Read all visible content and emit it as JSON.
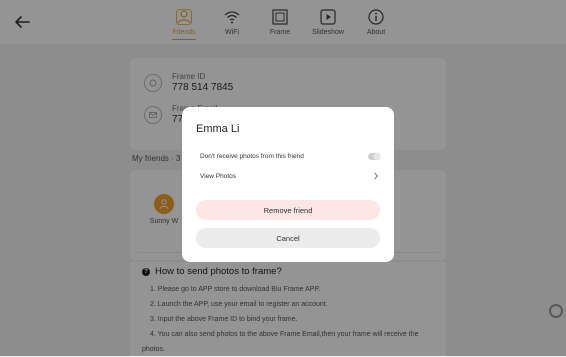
{
  "header": {
    "tabs": [
      {
        "label": "Friends",
        "icon": "friends-icon",
        "active": true
      },
      {
        "label": "WiFi",
        "icon": "wifi-icon",
        "active": false
      },
      {
        "label": "Frame",
        "icon": "frame-icon",
        "active": false
      },
      {
        "label": "Slideshow",
        "icon": "slideshow-icon",
        "active": false
      },
      {
        "label": "About",
        "icon": "info-icon",
        "active": false
      }
    ]
  },
  "info": {
    "frame_id_label": "Frame ID",
    "frame_id_value": "778 514 7845",
    "frame_email_label": "Frame Email",
    "frame_email_value": "778"
  },
  "friends": {
    "section_label": "My friends · 3",
    "items": [
      {
        "name": "Sunny W"
      }
    ]
  },
  "howto": {
    "title": "How to send photos to frame?",
    "steps": [
      "1. Please go to APP store to download Biu Frame APP.",
      "2. Launch the APP, use your email to register an account.",
      "3. Input the above Frame ID to bind your frame.",
      "4. You can also send photos to the above Frame Email,then your frame will receive the photos."
    ]
  },
  "dialog": {
    "title": "Emma Li",
    "block_label": "Don't receive photos from this friend",
    "view_label": "View Photos",
    "remove_label": "Remove friend",
    "cancel_label": "Cancel"
  },
  "colors": {
    "accent": "#e8a33d",
    "avatar": "#f2a22e",
    "remove_bg": "#fde6e6",
    "cancel_bg": "#ececec"
  }
}
